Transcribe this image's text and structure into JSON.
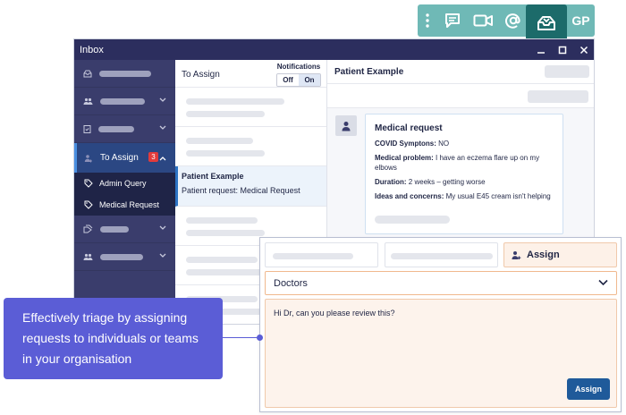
{
  "toolbar": {
    "icons": [
      "more-vertical-icon",
      "chat-icon",
      "video-icon",
      "at-icon",
      "inbox-icon"
    ],
    "avatar_initials": "GP"
  },
  "window": {
    "title": "Inbox"
  },
  "sidebar": {
    "active_item": {
      "label": "To Assign",
      "badge": "3"
    },
    "sub_items": [
      {
        "label": "Admin Query"
      },
      {
        "label": "Medical Request"
      }
    ]
  },
  "list": {
    "title": "To Assign",
    "notifications_label": "Notifications",
    "toggle_off": "Off",
    "toggle_on": "On",
    "selected": {
      "title": "Patient Example",
      "subtitle": "Patient request: Medical Request"
    }
  },
  "detail": {
    "title": "Patient Example",
    "card": {
      "heading": "Medical request",
      "fields": [
        {
          "label": "COVID Symptons:",
          "value": "NO"
        },
        {
          "label": "Medical problem:",
          "value": "I have an eczema flare up on my elbows"
        },
        {
          "label": "Duration:",
          "value": "2 weeks – getting worse"
        },
        {
          "label": "Ideas and concerns:",
          "value": "My usual E45 cream isn't helping"
        }
      ]
    }
  },
  "assign_popup": {
    "tab_label": "Assign",
    "select_value": "Doctors",
    "message": "Hi Dr, can you please review this?",
    "button_label": "Assign"
  },
  "callout": {
    "text": "Effectively triage by assigning requests to individuals or teams in your organisation"
  },
  "colors": {
    "toolbar": "#6fb9b6",
    "toolbar_active": "#1c6b6a",
    "sidebar": "#3a3d6c",
    "titlebar": "#2c2e5e",
    "callout": "#5b5dd6",
    "assign_button": "#1f5a9a",
    "badge": "#e23b3b"
  }
}
